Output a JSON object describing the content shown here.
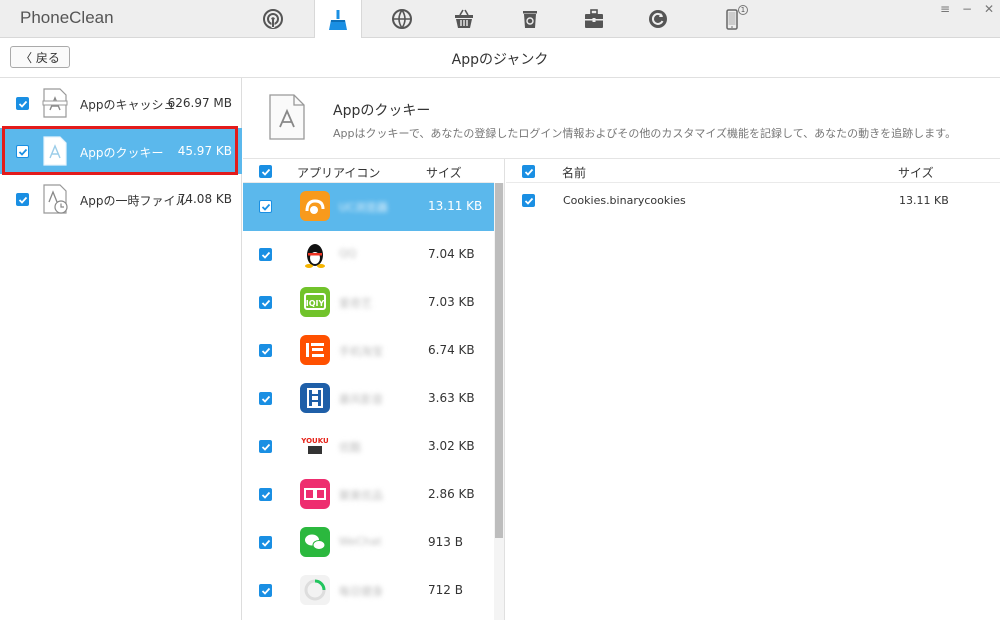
{
  "app": {
    "title": "PhoneClean",
    "badge": "1"
  },
  "nav": {
    "icons": [
      "wifi-sync-icon",
      "broom-clean-icon",
      "internet-globe-icon",
      "basket-icon",
      "trash-icon",
      "toolbox-icon",
      "restore-icon",
      "phone-icon"
    ],
    "active_index": 1,
    "window_controls": [
      "≡",
      "−",
      "✕"
    ]
  },
  "header": {
    "back_label": "〈 戻る",
    "title": "Appのジャンク"
  },
  "sidebar": {
    "items": [
      {
        "label": "Appのキャッシュ",
        "size": "626.97 MB",
        "selected": false
      },
      {
        "label": "Appのクッキー",
        "size": "45.97 KB",
        "selected": true
      },
      {
        "label": "Appの一時ファイル",
        "size": "74.08 KB",
        "selected": false
      }
    ]
  },
  "info": {
    "title": "Appのクッキー",
    "description": "Appはクッキーで、あなたの登録したログイン情報およびその他のカスタマイズ機能を記録して、あなたの動きを追跡します。"
  },
  "applist": {
    "col_icon": "アプリアイコン",
    "col_size": "サイズ",
    "rows": [
      {
        "name": "UC浏览器",
        "size": "13.11 KB",
        "icon": "uc-browser-icon",
        "color": "#f89a1c",
        "selected": true
      },
      {
        "name": "QQ",
        "size": "7.04 KB",
        "icon": "qq-penguin-icon",
        "color": "#ffffff",
        "selected": false
      },
      {
        "name": "爱奇艺",
        "size": "7.03 KB",
        "icon": "iqiyi-icon",
        "color": "#71c32b",
        "selected": false
      },
      {
        "name": "手机淘宝",
        "size": "6.74 KB",
        "icon": "taobao-icon",
        "color": "#ff5000",
        "selected": false
      },
      {
        "name": "暴风影音",
        "size": "3.63 KB",
        "icon": "film-strip-icon",
        "color": "#1f5fa8",
        "selected": false
      },
      {
        "name": "优酷",
        "size": "3.02 KB",
        "icon": "youku-icon",
        "color": "#ffffff",
        "selected": false
      },
      {
        "name": "聚美优品",
        "size": "2.86 KB",
        "icon": "jumei-icon",
        "color": "#ee2d6f",
        "selected": false
      },
      {
        "name": "WeChat",
        "size": "913 B",
        "icon": "wechat-icon",
        "color": "#2bb83e",
        "selected": false
      },
      {
        "name": "每日健身",
        "size": "712 B",
        "icon": "circle-progress-icon",
        "color": "#f2f2f2",
        "selected": false
      }
    ]
  },
  "filelist": {
    "col_name": "名前",
    "col_size": "サイズ",
    "rows": [
      {
        "name": "Cookies.binarycookies",
        "size": "13.11 KB"
      }
    ]
  },
  "colors": {
    "accent": "#1a8fe3",
    "selected_bg": "#5bb8ec",
    "highlight_border": "#e31b1b"
  }
}
